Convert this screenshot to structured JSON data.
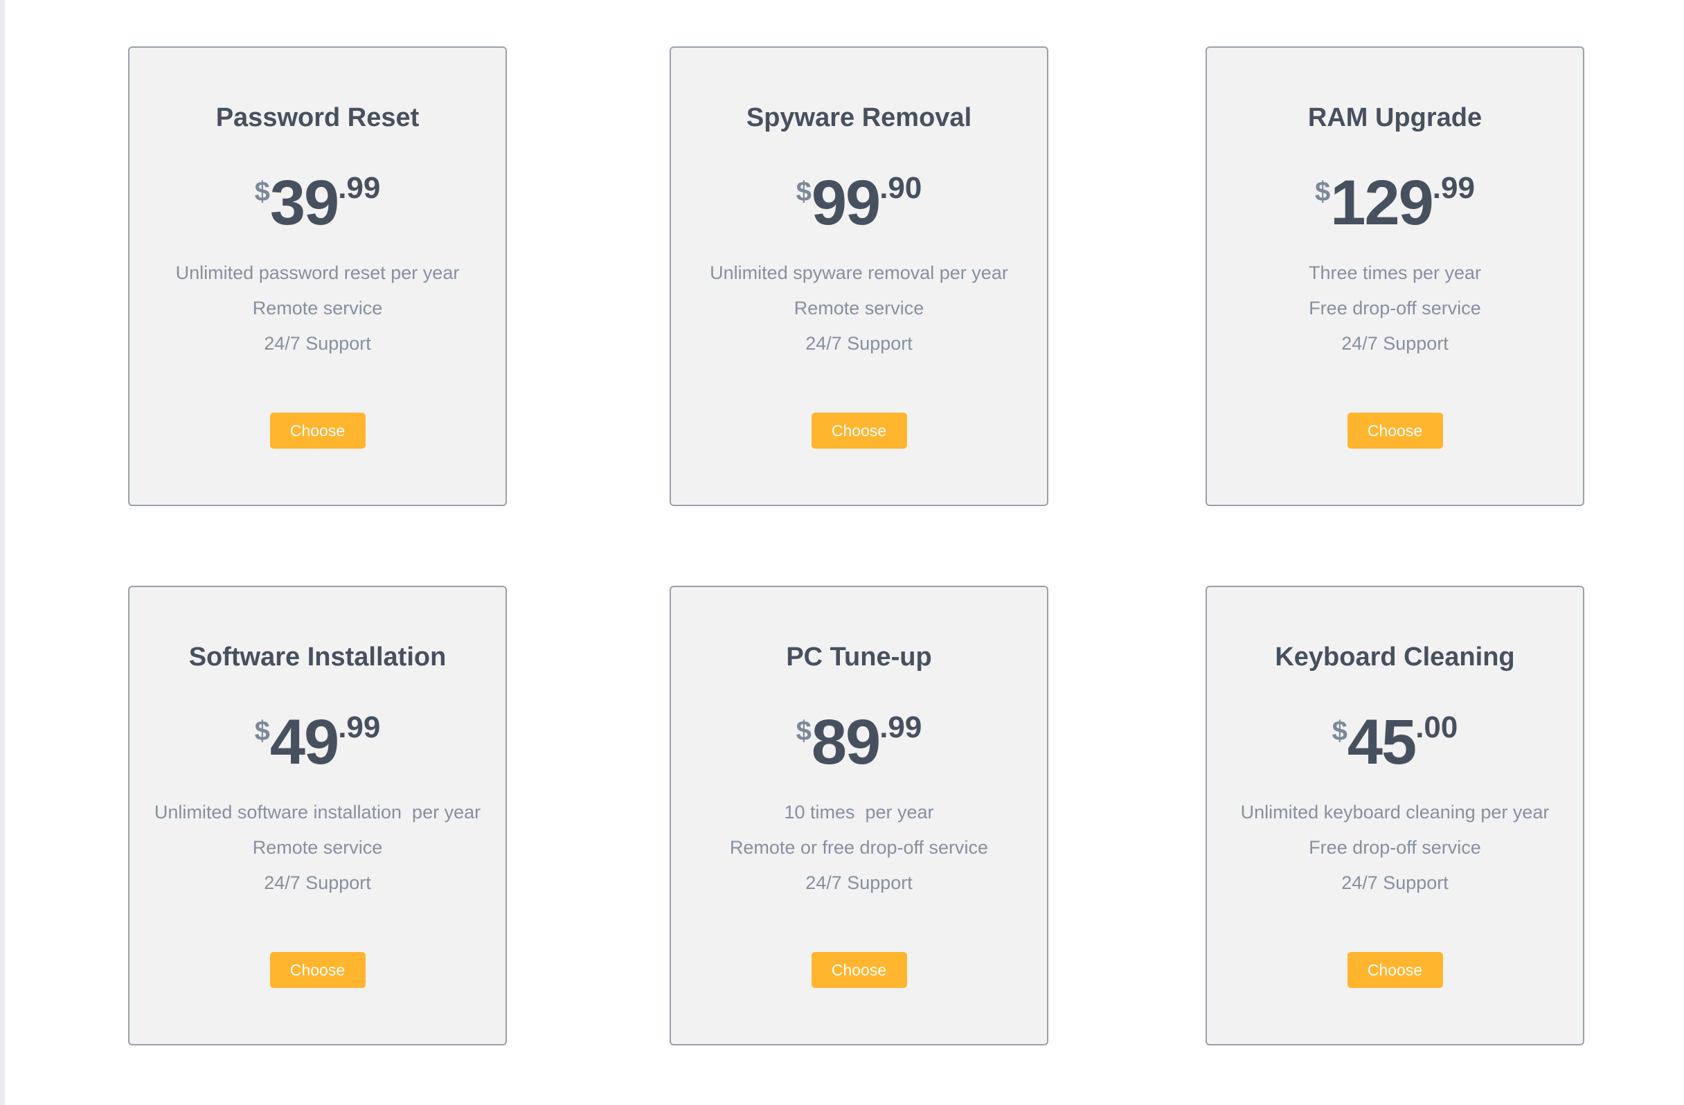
{
  "plans": [
    {
      "title": "Password Reset",
      "currency": "$",
      "price_whole": "39",
      "price_cents": ".99",
      "features": [
        "Unlimited password reset per year",
        "Remote service",
        "24/7 Support"
      ],
      "button_label": "Choose"
    },
    {
      "title": "Spyware Removal",
      "currency": "$",
      "price_whole": "99",
      "price_cents": ".90",
      "features": [
        "Unlimited spyware removal per year",
        "Remote service",
        "24/7 Support"
      ],
      "button_label": "Choose"
    },
    {
      "title": "RAM Upgrade",
      "currency": "$",
      "price_whole": "129",
      "price_cents": ".99",
      "features": [
        "Three times per year",
        "Free drop-off service",
        "24/7 Support"
      ],
      "button_label": "Choose"
    },
    {
      "title": "Software Installation",
      "currency": "$",
      "price_whole": "49",
      "price_cents": ".99",
      "features": [
        "Unlimited software installation  per year",
        "Remote service",
        "24/7 Support"
      ],
      "button_label": "Choose"
    },
    {
      "title": "PC Tune-up",
      "currency": "$",
      "price_whole": "89",
      "price_cents": ".99",
      "features": [
        "10 times  per year",
        "Remote or free drop-off service",
        "24/7 Support"
      ],
      "button_label": "Choose"
    },
    {
      "title": "Keyboard Cleaning",
      "currency": "$",
      "price_whole": "45",
      "price_cents": ".00",
      "features": [
        "Unlimited keyboard cleaning per year",
        "Free drop-off service",
        "24/7 Support"
      ],
      "button_label": "Choose"
    }
  ],
  "colors": {
    "card_background": "#f2f2f2",
    "card_border": "#9aa1ab",
    "title_text": "#47505e",
    "feature_text": "#8590a0",
    "currency_symbol": "#7c889a",
    "button_background": "#ffb52e",
    "button_text": "#ffffff"
  }
}
